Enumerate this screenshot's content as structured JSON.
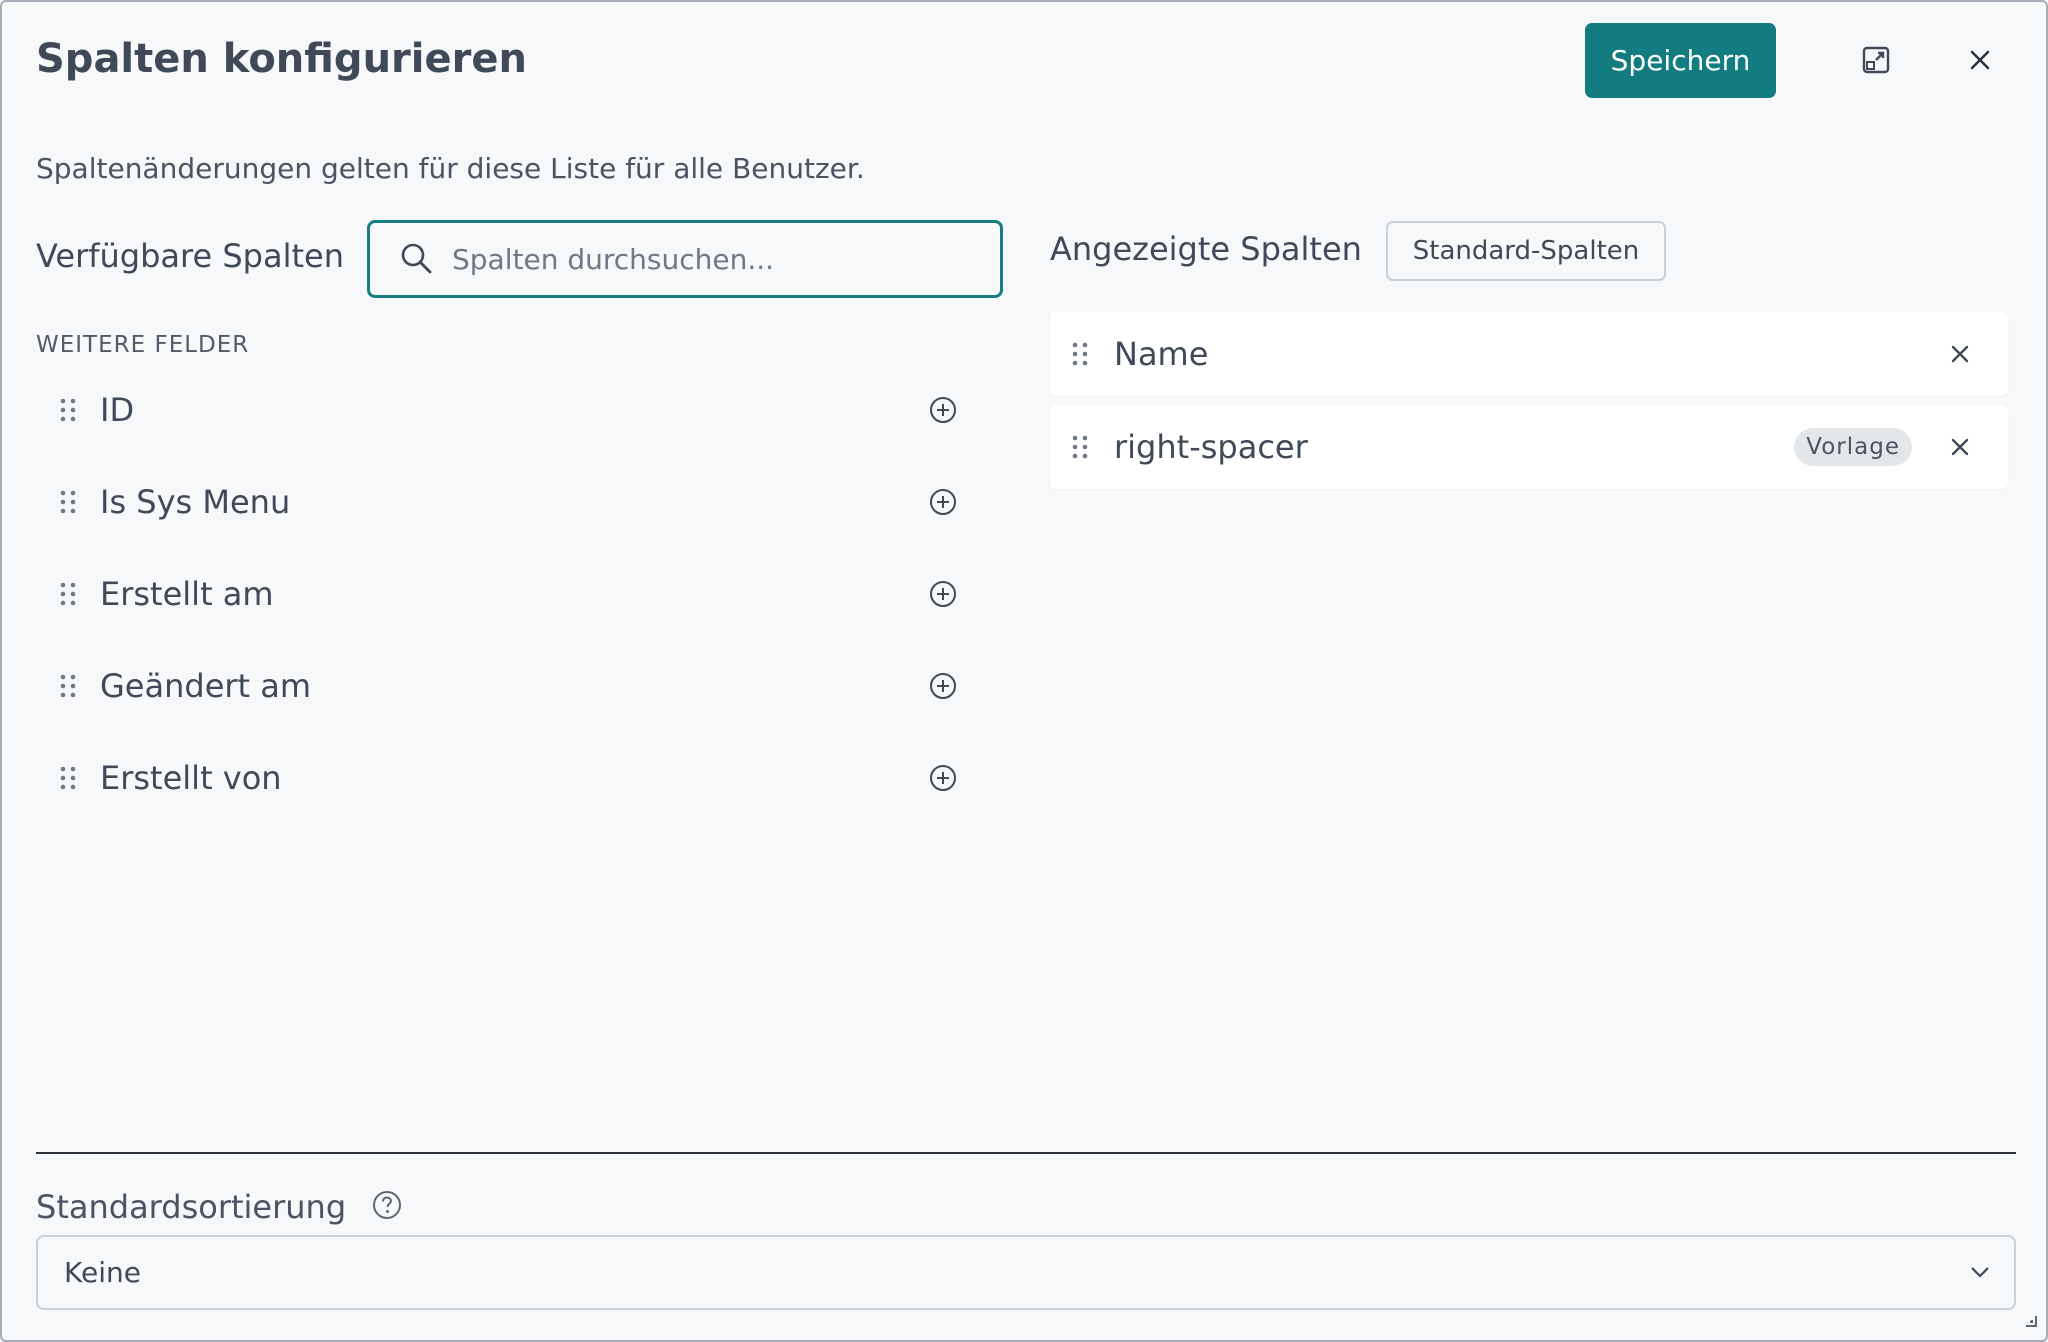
{
  "dialog": {
    "title": "Spalten konfigurieren",
    "save_label": "Speichern",
    "subtitle": "Spaltenänderungen gelten für diese Liste für alle Benutzer."
  },
  "available": {
    "heading": "Verfügbare Spalten",
    "search_placeholder": "Spalten durchsuchen...",
    "group_label": "WEITERE FELDER",
    "items": [
      {
        "label": "ID"
      },
      {
        "label": "Is Sys Menu"
      },
      {
        "label": "Erstellt am"
      },
      {
        "label": "Geändert am"
      },
      {
        "label": "Erstellt von"
      }
    ]
  },
  "shown": {
    "heading": "Angezeigte Spalten",
    "standard_label": "Standard-Spalten",
    "items": [
      {
        "label": "Name",
        "badge": ""
      },
      {
        "label": "right-spacer",
        "badge": "Vorlage"
      }
    ]
  },
  "sorting": {
    "label": "Standardsortierung",
    "value": "Keine"
  },
  "colors": {
    "accent": "#137c80",
    "text": "#404958",
    "background": "#f6f8fa"
  },
  "icons": {
    "expand": "expand-icon",
    "close": "close-icon",
    "search": "search-icon",
    "drag": "drag-handle-icon",
    "add": "add-circle-icon",
    "remove": "remove-icon",
    "help": "help-icon",
    "chevron": "chevron-down-icon"
  }
}
